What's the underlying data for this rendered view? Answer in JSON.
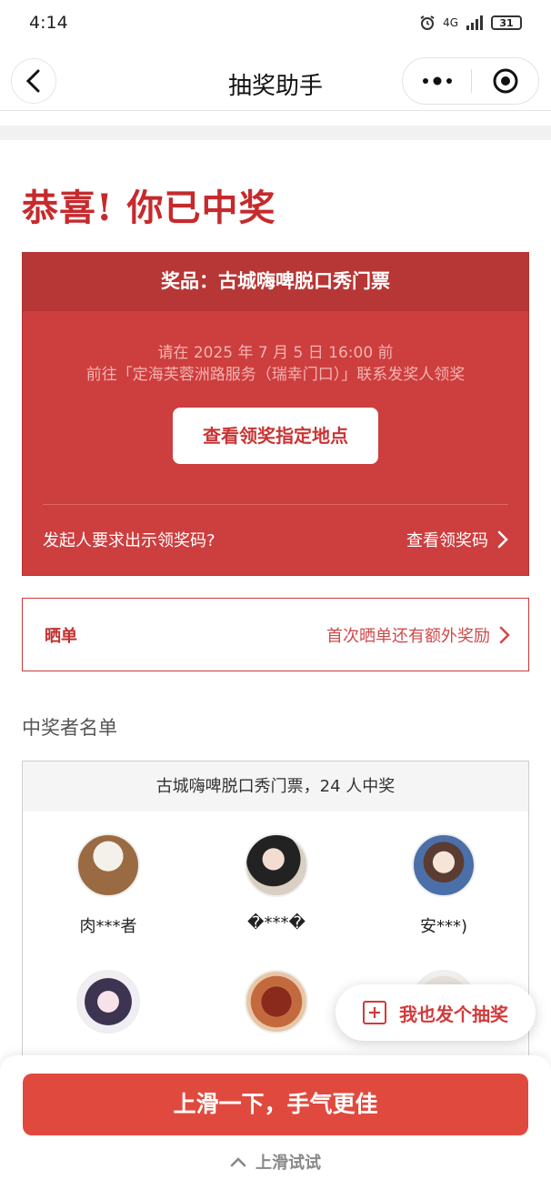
{
  "status_bar": {
    "time": "4:14",
    "network": "4G",
    "battery": "31"
  },
  "nav": {
    "title": "抽奖助手"
  },
  "headline": "恭喜! 你已中奖",
  "prize": {
    "title": "奖品：古城嗨啤脱口秀门票",
    "instruction_line1": "请在 2025 年 7 月 5 日 16:00 前",
    "instruction_line2": "前往「定海芙蓉洲路服务（瑞幸门口）」联系发奖人领奖",
    "locate_button": "查看领奖指定地点",
    "code_prompt": "发起人要求出示领奖码?",
    "code_link": "查看领奖码"
  },
  "share": {
    "title": "晒单",
    "link": "首次晒单还有额外奖励"
  },
  "winners": {
    "heading": "中奖者名单",
    "summary": "古城嗨啤脱口秀门票，24 人中奖",
    "list": [
      {
        "name": "肉***者",
        "avatar": "capybara-avatar"
      },
      {
        "name": "�***�",
        "avatar": "girl-photo-avatar"
      },
      {
        "name": "安***)",
        "avatar": "anime-girl-glasses-avatar"
      },
      {
        "name": "",
        "avatar": "anime-girl-avatar"
      },
      {
        "name": "",
        "avatar": "dates-food-avatar"
      },
      {
        "name": "",
        "avatar": "blurred-avatar"
      }
    ]
  },
  "fab": {
    "label": "我也发个抽奖"
  },
  "bottom": {
    "swipe_button": "上滑一下，手气更佳",
    "swipe_hint": "上滑试试"
  },
  "colors": {
    "brand_red": "#c62a2c",
    "card_red": "#cd3e3e",
    "button_red": "#e04a3e"
  }
}
